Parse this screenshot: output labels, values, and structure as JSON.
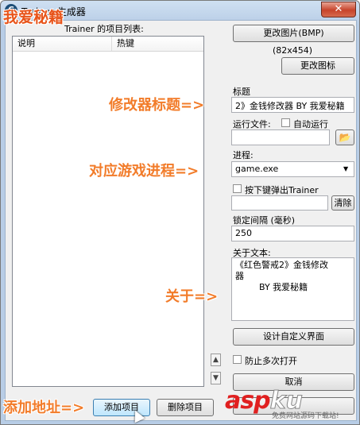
{
  "window": {
    "title": "Trainer 生成器",
    "close_glyph": "✕"
  },
  "overlay": {
    "logo": "我爱秘籍",
    "label_title": "修改器标题=>",
    "label_process": "对应游戏进程=>",
    "label_about": "关于=>",
    "label_add": "添加地址=>"
  },
  "left": {
    "list_label": "Trainer 的项目列表:",
    "columns": [
      "说明",
      "热键"
    ],
    "up_glyph": "▲",
    "down_glyph": "▼",
    "add_button": "添加项目",
    "delete_button": "删除项目"
  },
  "right": {
    "change_image_button": "更改图片(BMP)",
    "image_size": "(82x454)",
    "change_icon_button": "更改图标",
    "title_label": "标题",
    "title_value": "2》金钱修改器 BY 我爱秘籍",
    "run_file_label": "运行文件:",
    "auto_run_label": "自动运行",
    "run_file_value": "",
    "folder_icon": "📂",
    "process_label": "进程:",
    "process_value": "game.exe",
    "dropdown_glyph": "▼",
    "hotkey_label": "按下键弹出Trainer",
    "hotkey_value": "",
    "clear_button": "清除",
    "interval_label": "锁定间隔 (毫秒)",
    "interval_value": "250",
    "about_label": "关于文本:",
    "about_line1": "《红色警戒2》金钱修改",
    "about_line2": "器",
    "about_line3": "BY 我爱秘籍",
    "design_button": "设计自定义界面",
    "prevent_multi_label": "防止多次打开",
    "cancel_button": "取消"
  },
  "watermark": {
    "asp": "asp",
    "ku": "ku",
    "sub": "免费网站源码下载站!"
  }
}
